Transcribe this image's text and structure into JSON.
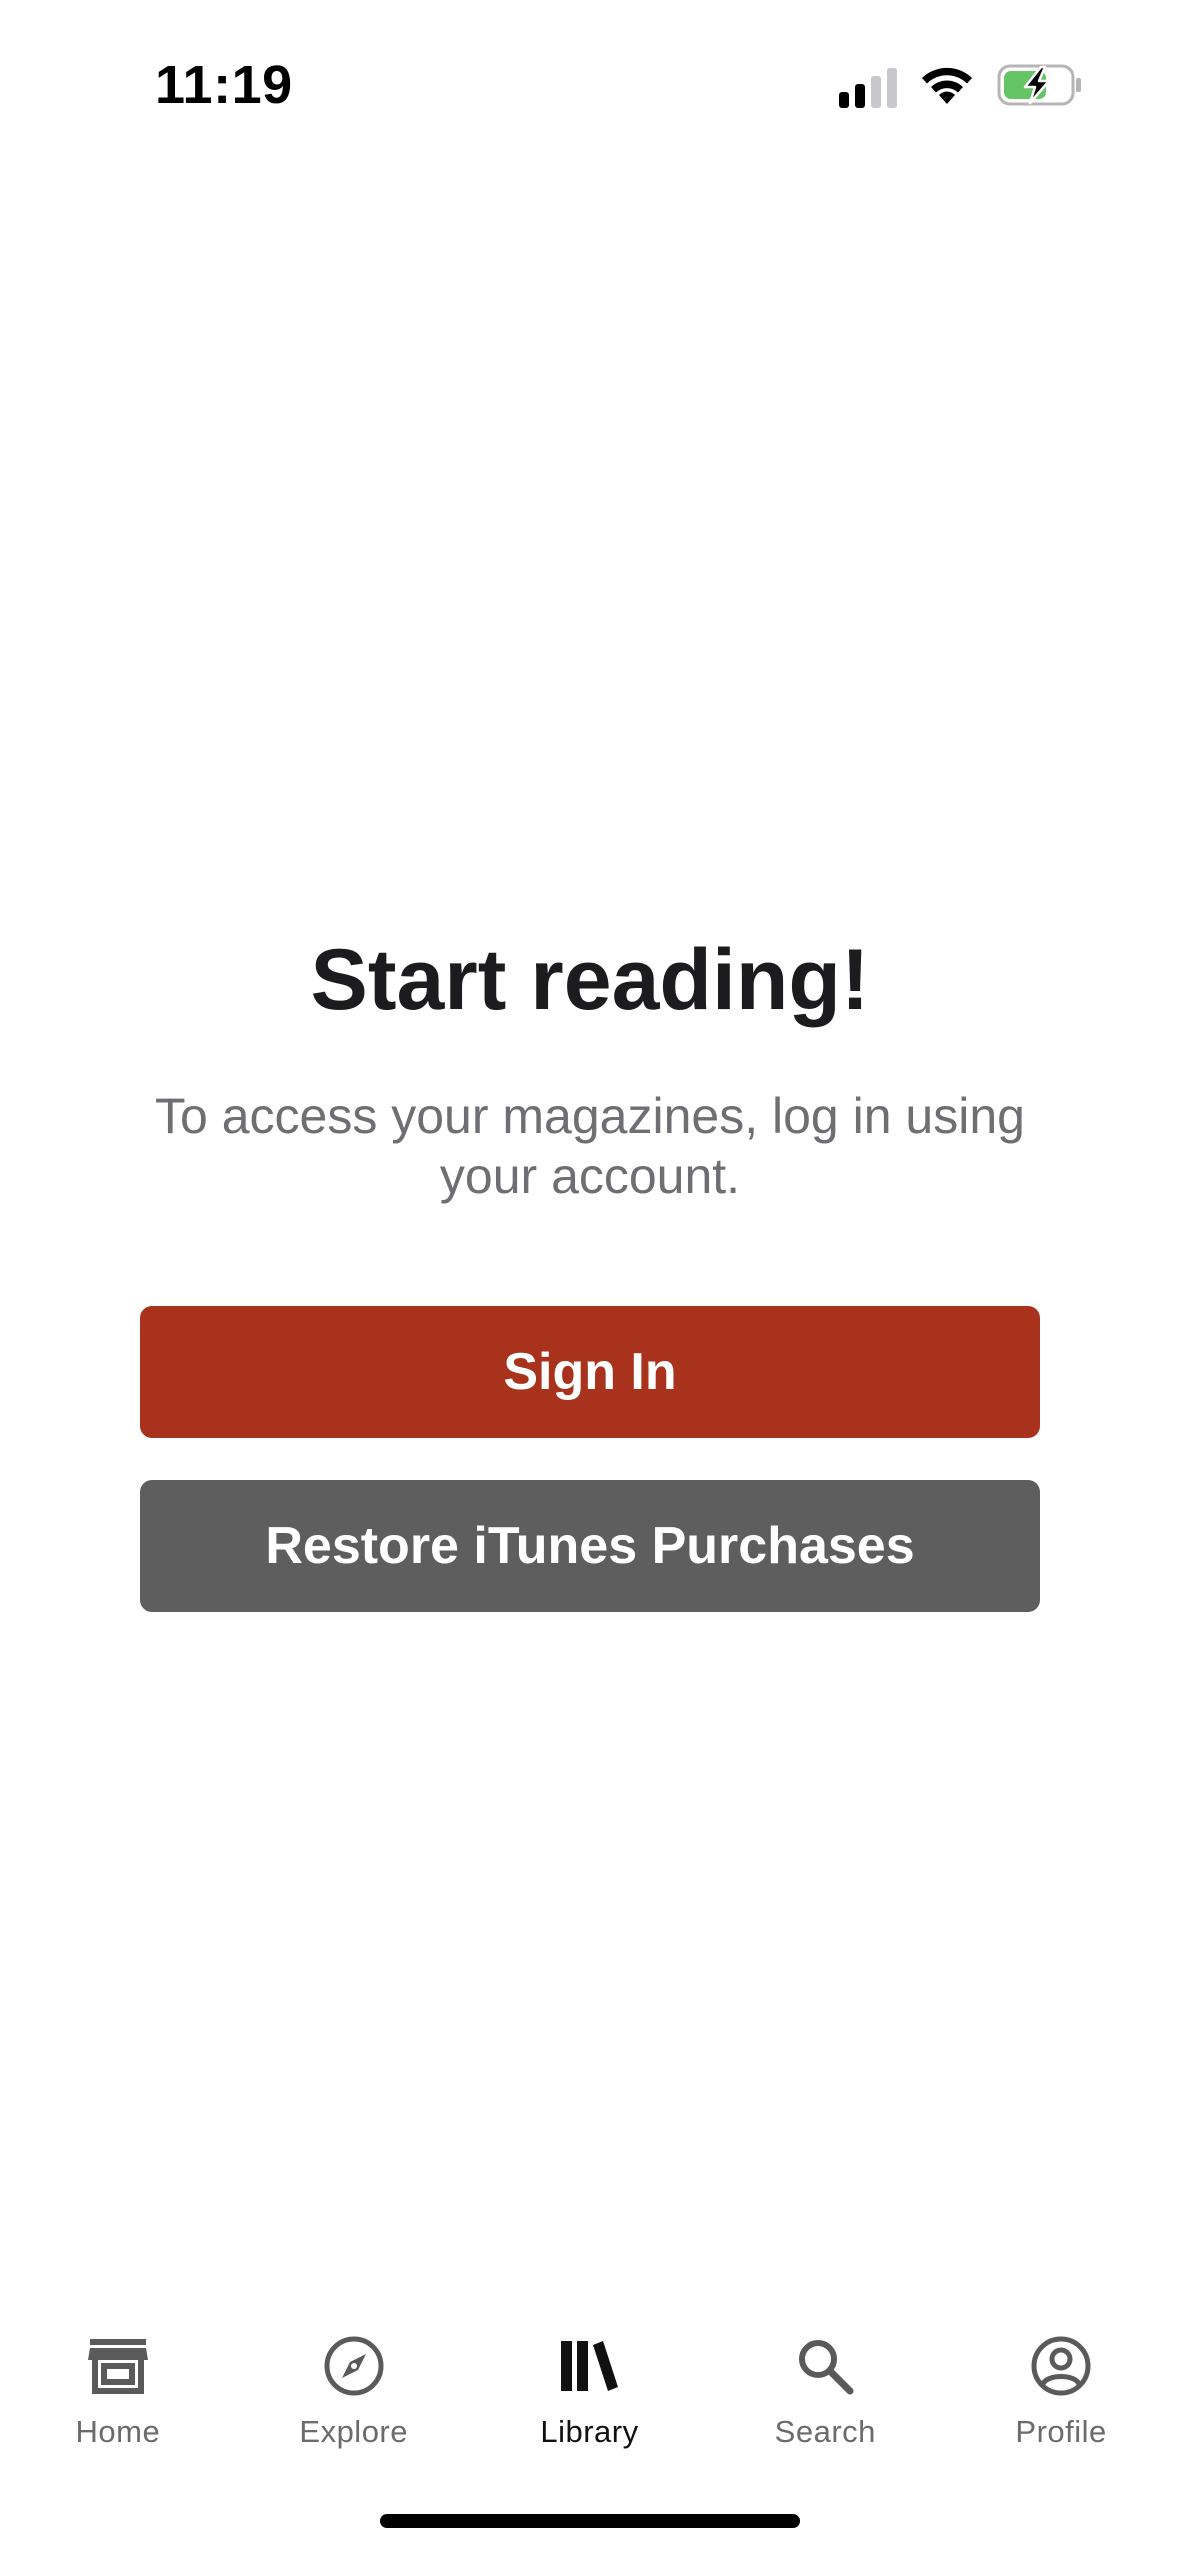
{
  "status_bar": {
    "time": "11:19"
  },
  "main": {
    "title": "Start reading!",
    "subtitle": "To access your magazines, log in using your account.",
    "sign_in_label": "Sign In",
    "restore_label": "Restore iTunes Purchases"
  },
  "colors": {
    "sign_in_bg": "#a8321c",
    "restore_bg": "#5e5e5e",
    "battery_fill": "#65c466"
  },
  "tab_bar": {
    "tabs": [
      {
        "label": "Home",
        "icon": "store-icon"
      },
      {
        "label": "Explore",
        "icon": "compass-icon"
      },
      {
        "label": "Library",
        "icon": "library-icon",
        "active": true
      },
      {
        "label": "Search",
        "icon": "search-icon"
      },
      {
        "label": "Profile",
        "icon": "account-circle-icon"
      }
    ]
  }
}
